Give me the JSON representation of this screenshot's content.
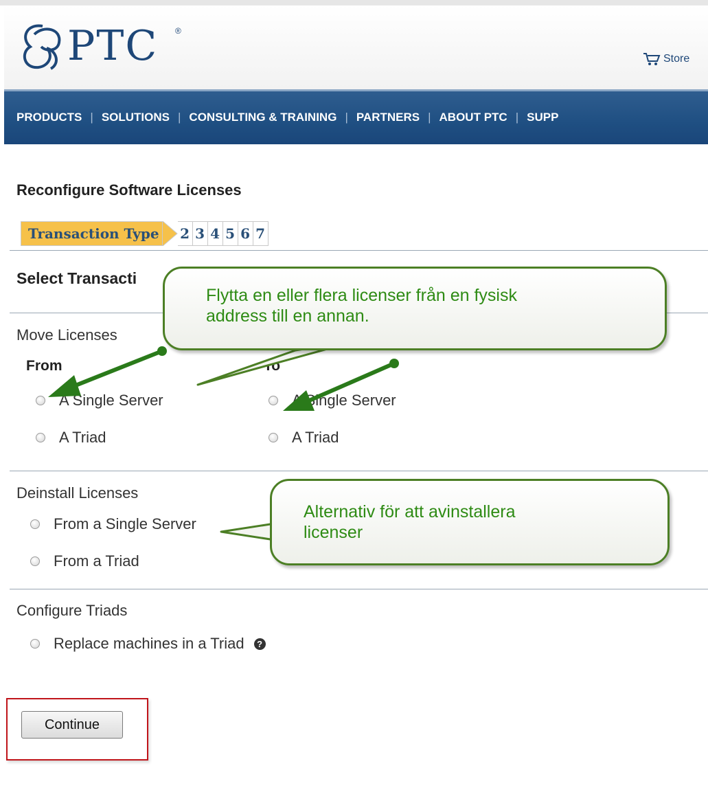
{
  "header": {
    "logo_text": "PTC",
    "logo_reg": "®",
    "store_label": "Store"
  },
  "nav": {
    "items": [
      "PRODUCTS",
      "SOLUTIONS",
      "CONSULTING & TRAINING",
      "PARTNERS",
      "ABOUT PTC",
      "SUPP"
    ],
    "separator": "|"
  },
  "page": {
    "title": "Reconfigure Software Licenses",
    "steps": {
      "active": "Transaction Type",
      "numbers": [
        "2",
        "3",
        "4",
        "5",
        "6",
        "7"
      ]
    },
    "section_title": "Select Transacti",
    "move": {
      "title": "Move Licenses",
      "from_label": "From",
      "to_label": "To",
      "from_options": [
        "A Single Server",
        "A Triad"
      ],
      "to_options": [
        "A Single Server",
        "A Triad"
      ]
    },
    "deinstall": {
      "title": "Deinstall Licenses",
      "options": [
        "From a Single Server",
        "From a Triad"
      ]
    },
    "configure": {
      "title": "Configure Triads",
      "option": "Replace machines in a Triad",
      "help_glyph": "?"
    },
    "continue_label": "Continue"
  },
  "callouts": {
    "move": {
      "line1": "Flytta en eller flera licenser från en fysisk",
      "line2": "address till en annan."
    },
    "deinstall": {
      "line1": "Alternativ för att avinstallera",
      "line2": "licenser"
    }
  },
  "colors": {
    "nav_bg": "#1f4f82",
    "step_active": "#f6c14a",
    "callout_border": "#4c7f25",
    "callout_text": "#2e8b14",
    "arrow": "#2a7a1a",
    "highlight_box": "#c0141a"
  }
}
